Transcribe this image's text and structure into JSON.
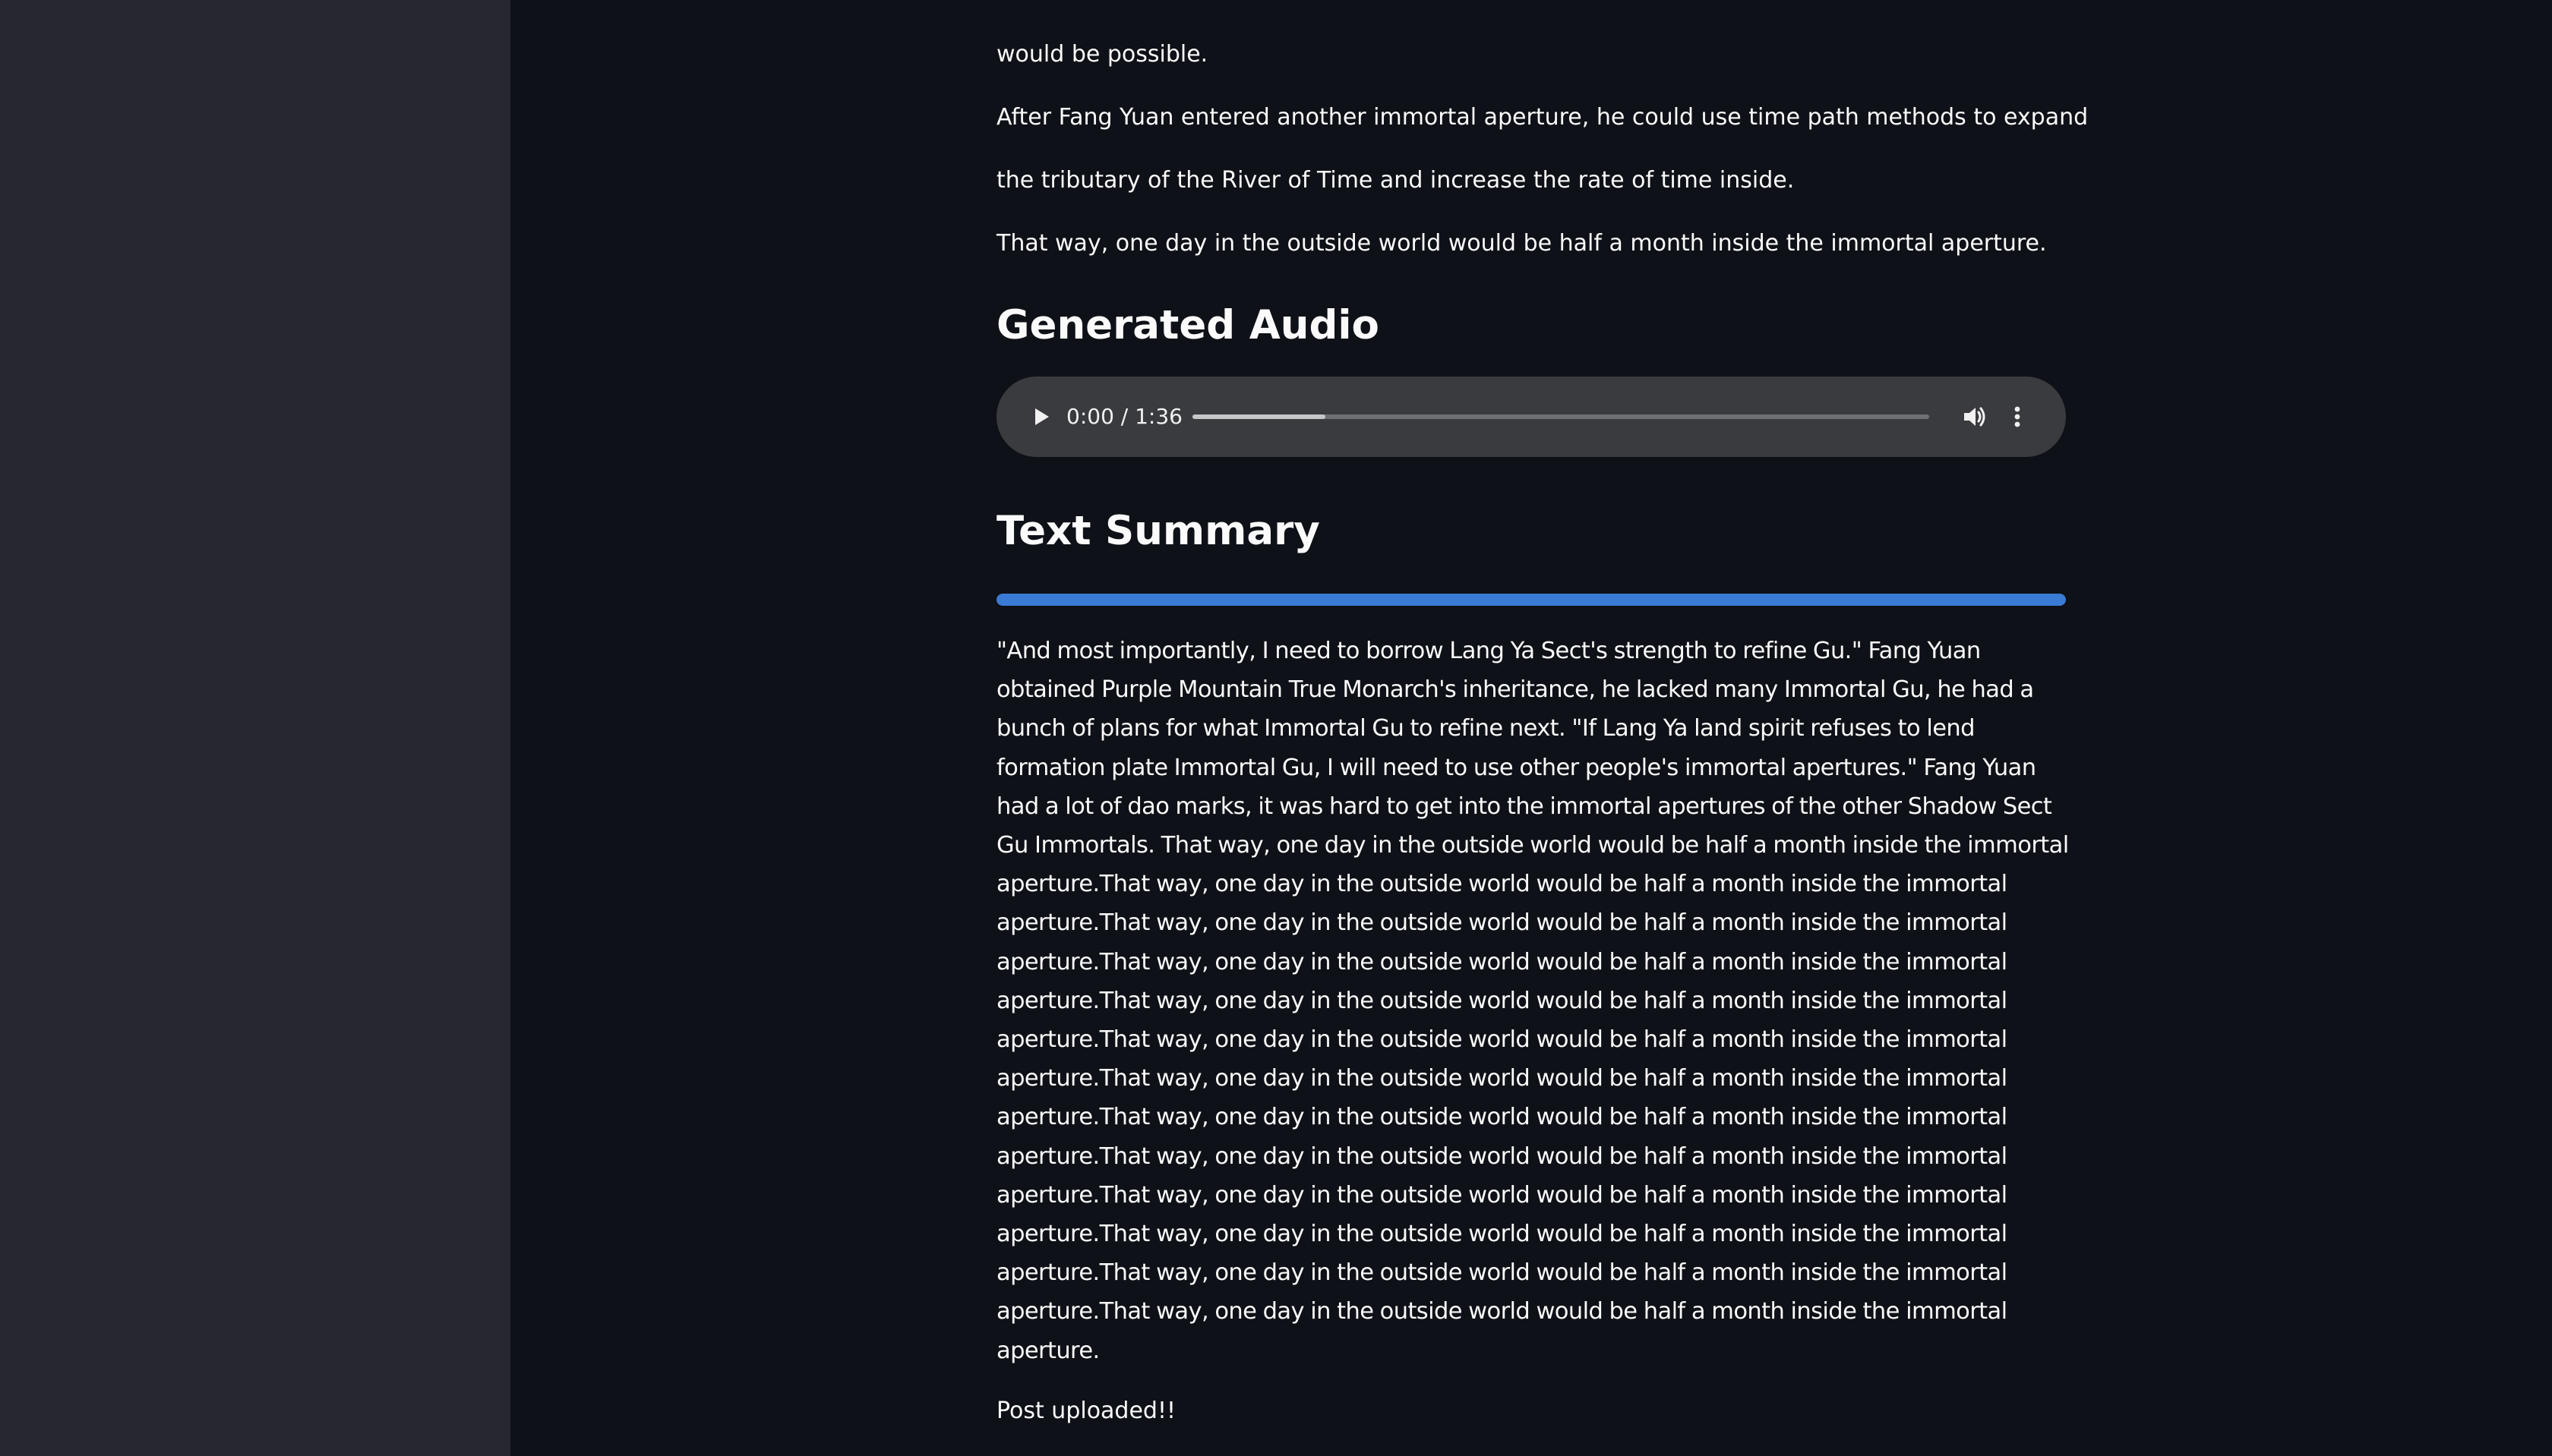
{
  "previous_text": {
    "line_1": "would be possible.",
    "line_2": "After Fang Yuan entered another immortal aperture, he could use time path methods to expand",
    "line_3": "the tributary of the River of Time and increase the rate of time inside.",
    "line_4": "That way, one day in the outside world would be half a month inside the immortal aperture."
  },
  "audio_section": {
    "heading": "Generated Audio",
    "player": {
      "time_display": "0:00 / 1:36",
      "buffered_fraction": 0.18,
      "play_icon": "play-icon",
      "volume_icon": "volume-icon",
      "more_icon": "more-vertical-icon"
    }
  },
  "summary_section": {
    "heading": "Text Summary",
    "progress_fraction": 1.0,
    "progress_color": "#3a7bd5",
    "text": "\"And most importantly, I need to borrow Lang Ya Sect's strength to refine Gu.\" Fang Yuan obtained Purple Mountain True Monarch's inheritance, he lacked many Immortal Gu, he had a bunch of plans for what Immortal Gu to refine next. \"If Lang Ya land spirit refuses to lend formation plate Immortal Gu, I will need to use other people's immortal apertures.\" Fang Yuan had a lot of dao marks, it was hard to get into the immortal apertures of the other Shadow Sect Gu Immortals. That way, one day in the outside world would be half a month inside the immortal aperture.That way, one day in the outside world would be half a month inside the immortal aperture.That way, one day in the outside world would be half a month inside the immortal aperture.That way, one day in the outside world would be half a month inside the immortal aperture.That way, one day in the outside world would be half a month inside the immortal aperture.That way, one day in the outside world would be half a month inside the immortal aperture.That way, one day in the outside world would be half a month inside the immortal aperture.That way, one day in the outside world would be half a month inside the immortal aperture.That way, one day in the outside world would be half a month inside the immortal aperture.That way, one day in the outside world would be half a month inside the immortal aperture.That way, one day in the outside world would be half a month inside the immortal aperture.That way, one day in the outside world would be half a month inside the immortal aperture.That way, one day in the outside world would be half a month inside the immortal aperture."
  },
  "status": {
    "message": "Post uploaded!!"
  },
  "colors": {
    "background": "#0e1117",
    "sidebar": "#262730",
    "text": "#fafafa",
    "audio_player": "#3a3b3f"
  }
}
